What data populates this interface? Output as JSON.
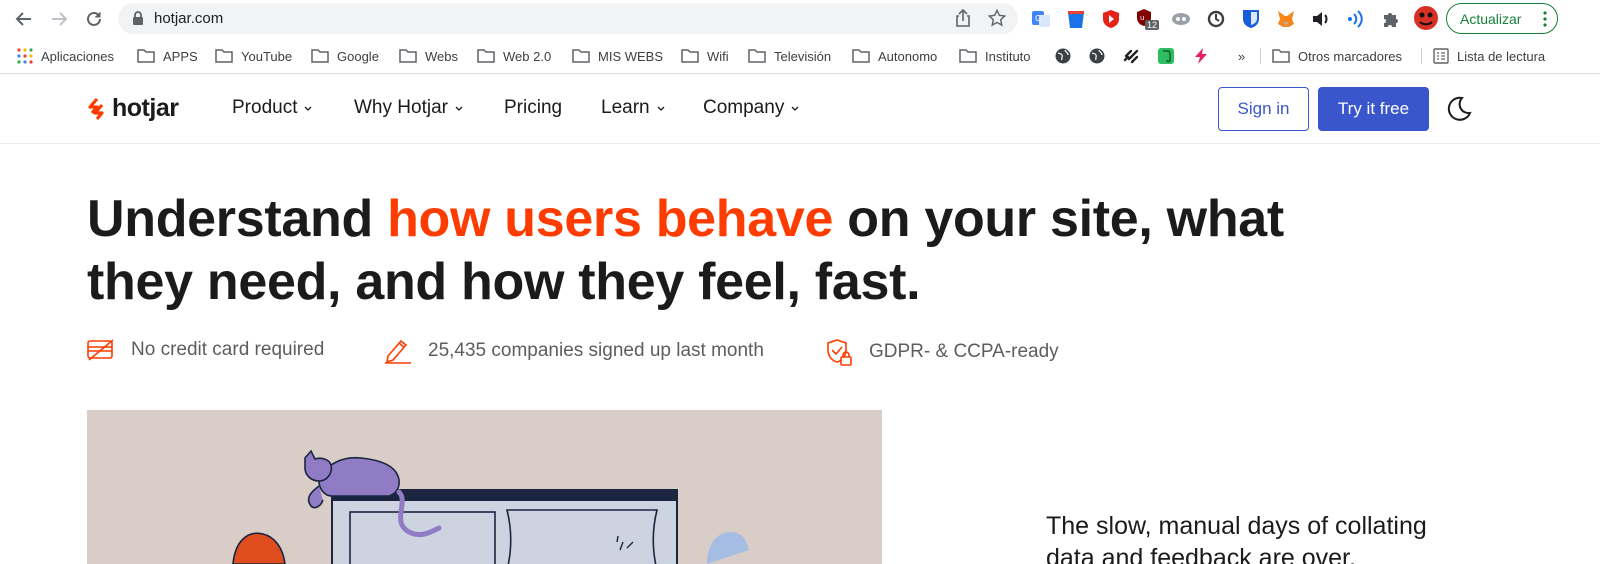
{
  "browser": {
    "url": "hotjar.com",
    "update_label": "Actualizar",
    "extension_badge": "12",
    "bookmarks": [
      {
        "label": "Aplicaciones"
      },
      {
        "label": "APPS"
      },
      {
        "label": "YouTube"
      },
      {
        "label": "Google"
      },
      {
        "label": "Webs"
      },
      {
        "label": "Web 2.0"
      },
      {
        "label": "MIS WEBS"
      },
      {
        "label": "Wifi"
      },
      {
        "label": "Televisión"
      },
      {
        "label": "Autonomo"
      },
      {
        "label": "Instituto"
      }
    ],
    "overflow": "»",
    "other_bookmarks": "Otros marcadores",
    "reading_list": "Lista de lectura"
  },
  "site": {
    "logo": "hotjar",
    "nav": [
      {
        "label": "Product",
        "dropdown": true
      },
      {
        "label": "Why Hotjar",
        "dropdown": true
      },
      {
        "label": "Pricing",
        "dropdown": false
      },
      {
        "label": "Learn",
        "dropdown": true
      },
      {
        "label": "Company",
        "dropdown": true
      }
    ],
    "sign_in": "Sign in",
    "try_free": "Try it free"
  },
  "hero": {
    "title_part1": "Understand ",
    "title_accent": "how users behave",
    "title_part2": " on your site, what they need, and how they feel, fast.",
    "features": [
      {
        "icon": "credit-card-icon",
        "text": "No credit card required"
      },
      {
        "icon": "pencil-icon",
        "text": "25,435 companies signed up last month"
      },
      {
        "icon": "shield-lock-icon",
        "text": "GDPR- & CCPA-ready"
      }
    ],
    "side_text": "The slow, manual days of collating data and feedback are over."
  },
  "colors": {
    "accent": "#ff3c00",
    "primary": "#3a56cc",
    "text": "#1b1b1b",
    "muted": "#5d5d5d",
    "illustration_bg": "#d8cdc7"
  }
}
